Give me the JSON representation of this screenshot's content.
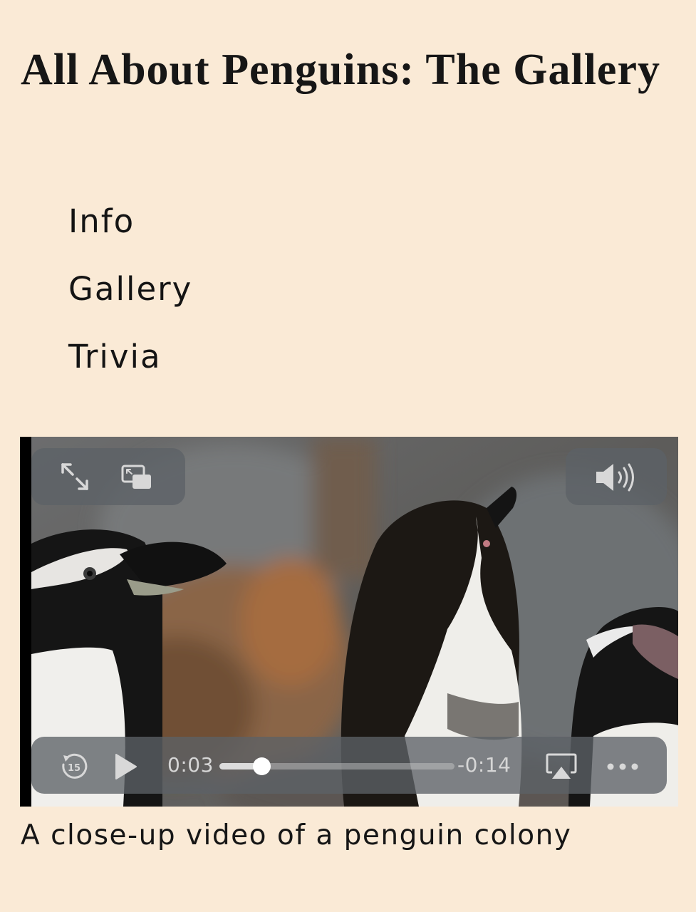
{
  "header": {
    "title": "All About Penguins: The Gallery"
  },
  "nav": {
    "items": [
      {
        "label": "Info"
      },
      {
        "label": "Gallery"
      },
      {
        "label": "Trivia"
      }
    ]
  },
  "video": {
    "skip_back_seconds": "15",
    "current_time": "0:03",
    "remaining_time": "-0:14",
    "progress_fraction": 0.18,
    "icons": {
      "fullscreen": "expand-arrows-icon",
      "picture_in_picture": "picture-in-picture-icon",
      "volume": "speaker-volume-icon",
      "skip_back": "skip-back-15-icon",
      "play": "play-icon",
      "airplay": "airplay-icon",
      "more": "more-dots-icon"
    },
    "colors": {
      "overlay": "#5c6266",
      "control_icon": "#d8d8d8",
      "scrubber_fill": "#dcdcdc"
    }
  },
  "caption": {
    "text": "A close-up video of a penguin colony"
  },
  "colors": {
    "background": "#faead6",
    "text": "#111111"
  }
}
